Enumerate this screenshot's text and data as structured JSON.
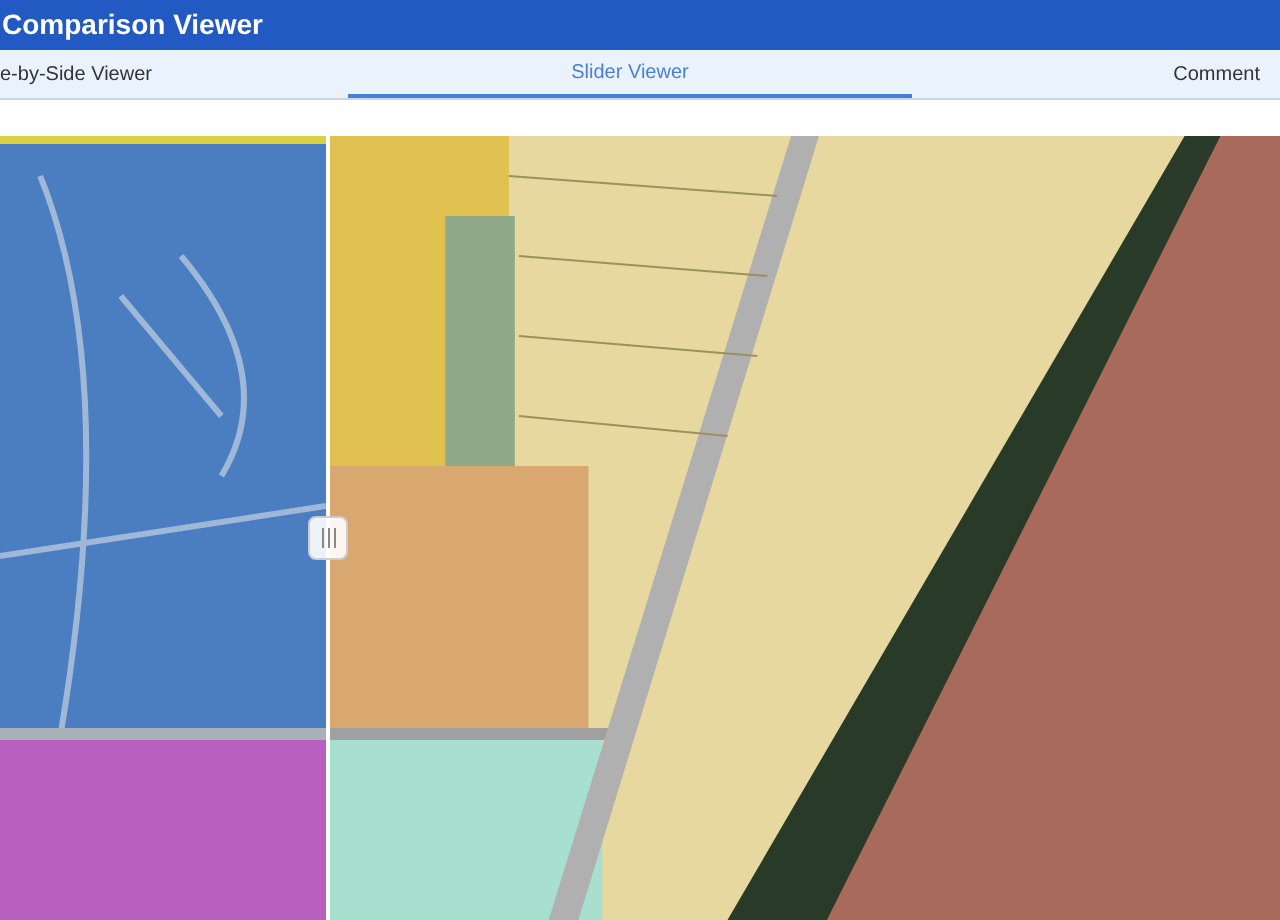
{
  "header": {
    "title": "Comparison Viewer"
  },
  "tabs": [
    {
      "label": "e-by-Side Viewer",
      "selected": false
    },
    {
      "label": "Slider Viewer",
      "selected": true
    },
    {
      "label": "Comment",
      "selected": false
    }
  ],
  "slider": {
    "level": 0.254
  }
}
